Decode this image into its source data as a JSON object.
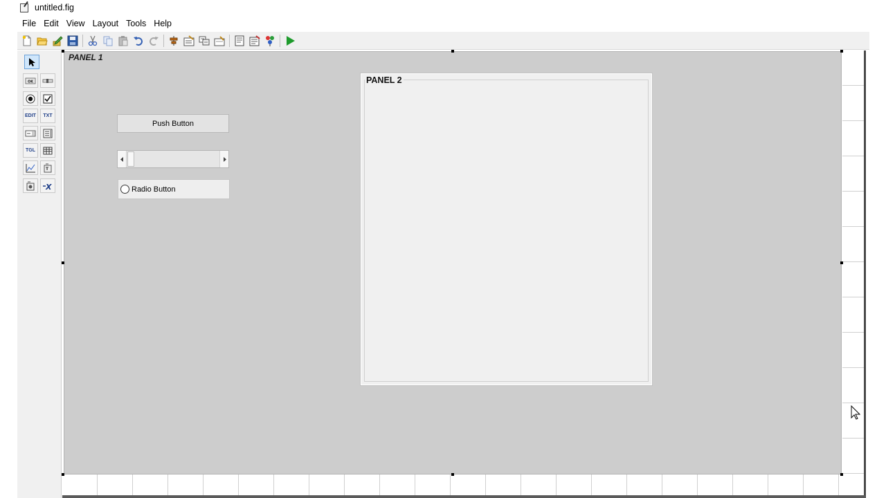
{
  "window": {
    "title": "untitled.fig"
  },
  "menu": {
    "items": [
      "File",
      "Edit",
      "View",
      "Layout",
      "Tools",
      "Help"
    ]
  },
  "toolbar": {
    "buttons": [
      {
        "name": "new-icon"
      },
      {
        "name": "open-icon"
      },
      {
        "name": "edit-icon"
      },
      {
        "name": "save-icon"
      },
      {
        "name": "cut-icon"
      },
      {
        "name": "copy-icon"
      },
      {
        "name": "paste-icon"
      },
      {
        "name": "undo-icon"
      },
      {
        "name": "redo-icon"
      },
      {
        "name": "align-icon"
      },
      {
        "name": "menu-editor-icon"
      },
      {
        "name": "tab-order-icon"
      },
      {
        "name": "toolbar-editor-icon"
      },
      {
        "name": "editor-icon"
      },
      {
        "name": "property-inspector-icon"
      },
      {
        "name": "object-browser-icon"
      },
      {
        "name": "run-icon"
      }
    ],
    "run_color": "#1e9b2c"
  },
  "palette": {
    "items": [
      {
        "name": "select-tool-icon",
        "label": "",
        "selected": true
      },
      {
        "name": "push-button-tool-icon",
        "label": "OK"
      },
      {
        "name": "slider-tool-icon",
        "label": ""
      },
      {
        "name": "radio-button-tool-icon",
        "label": ""
      },
      {
        "name": "check-box-tool-icon",
        "label": ""
      },
      {
        "name": "edit-text-tool-icon",
        "label": "EDIT"
      },
      {
        "name": "static-text-tool-icon",
        "label": "TXT"
      },
      {
        "name": "popup-menu-tool-icon",
        "label": ""
      },
      {
        "name": "listbox-tool-icon",
        "label": ""
      },
      {
        "name": "toggle-button-tool-icon",
        "label": "TGL"
      },
      {
        "name": "table-tool-icon",
        "label": ""
      },
      {
        "name": "axes-tool-icon",
        "label": ""
      },
      {
        "name": "panel-tool-icon",
        "label": ""
      },
      {
        "name": "button-group-tool-icon",
        "label": ""
      },
      {
        "name": "activex-tool-icon",
        "label": "X"
      }
    ]
  },
  "canvas": {
    "panel1": {
      "title": "PANEL 1"
    },
    "panel2": {
      "title": "PANEL 2"
    },
    "push_button": {
      "label": "Push Button"
    },
    "radio_button": {
      "label": "Radio Button"
    }
  }
}
